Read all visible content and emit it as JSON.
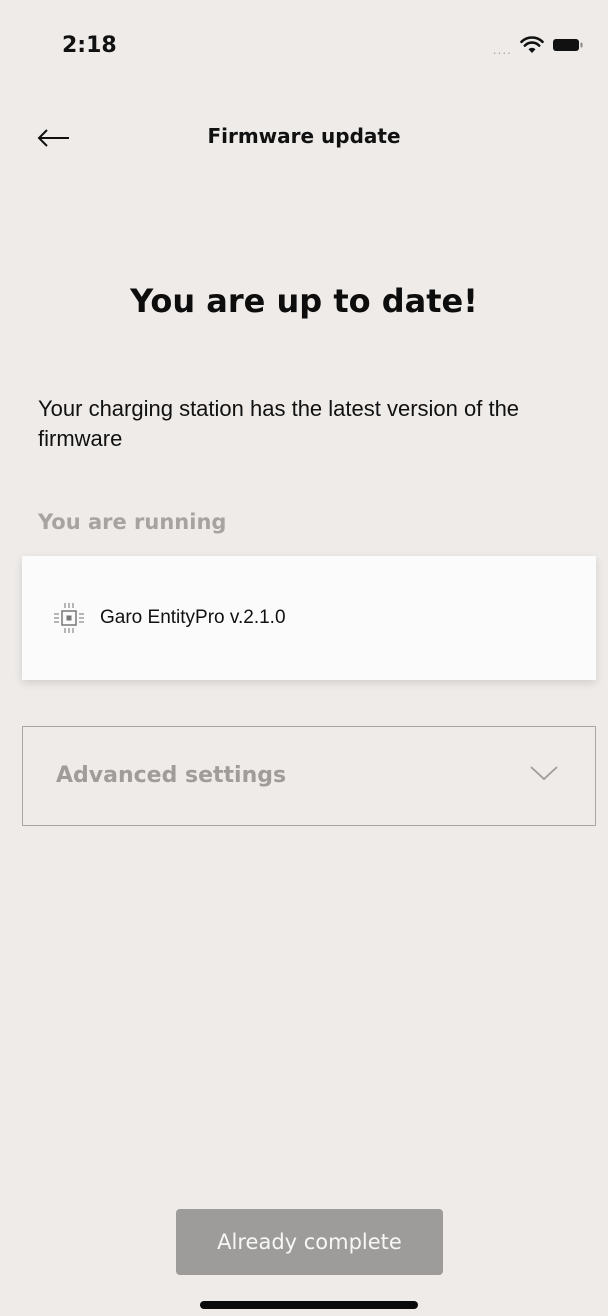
{
  "status_bar": {
    "time": "2:18",
    "signal_dots": "....",
    "icons": [
      "wifi-icon",
      "battery-icon"
    ]
  },
  "nav": {
    "back_icon": "arrow-left-icon",
    "title": "Firmware update"
  },
  "main": {
    "headline": "You are up to date!",
    "description": "Your charging station has the latest version of the firmware",
    "section_label": "You are running",
    "firmware": {
      "icon": "chip-icon",
      "name": "Garo EntityPro v.2.1.0"
    },
    "advanced": {
      "label": "Advanced settings",
      "icon": "chevron-down-icon"
    }
  },
  "footer": {
    "button_label": "Already complete"
  },
  "colors": {
    "background": "#eeebe9",
    "card": "#fbfbfb",
    "muted_text": "#a6a3a1",
    "disabled_button": "#9d9c9b"
  }
}
